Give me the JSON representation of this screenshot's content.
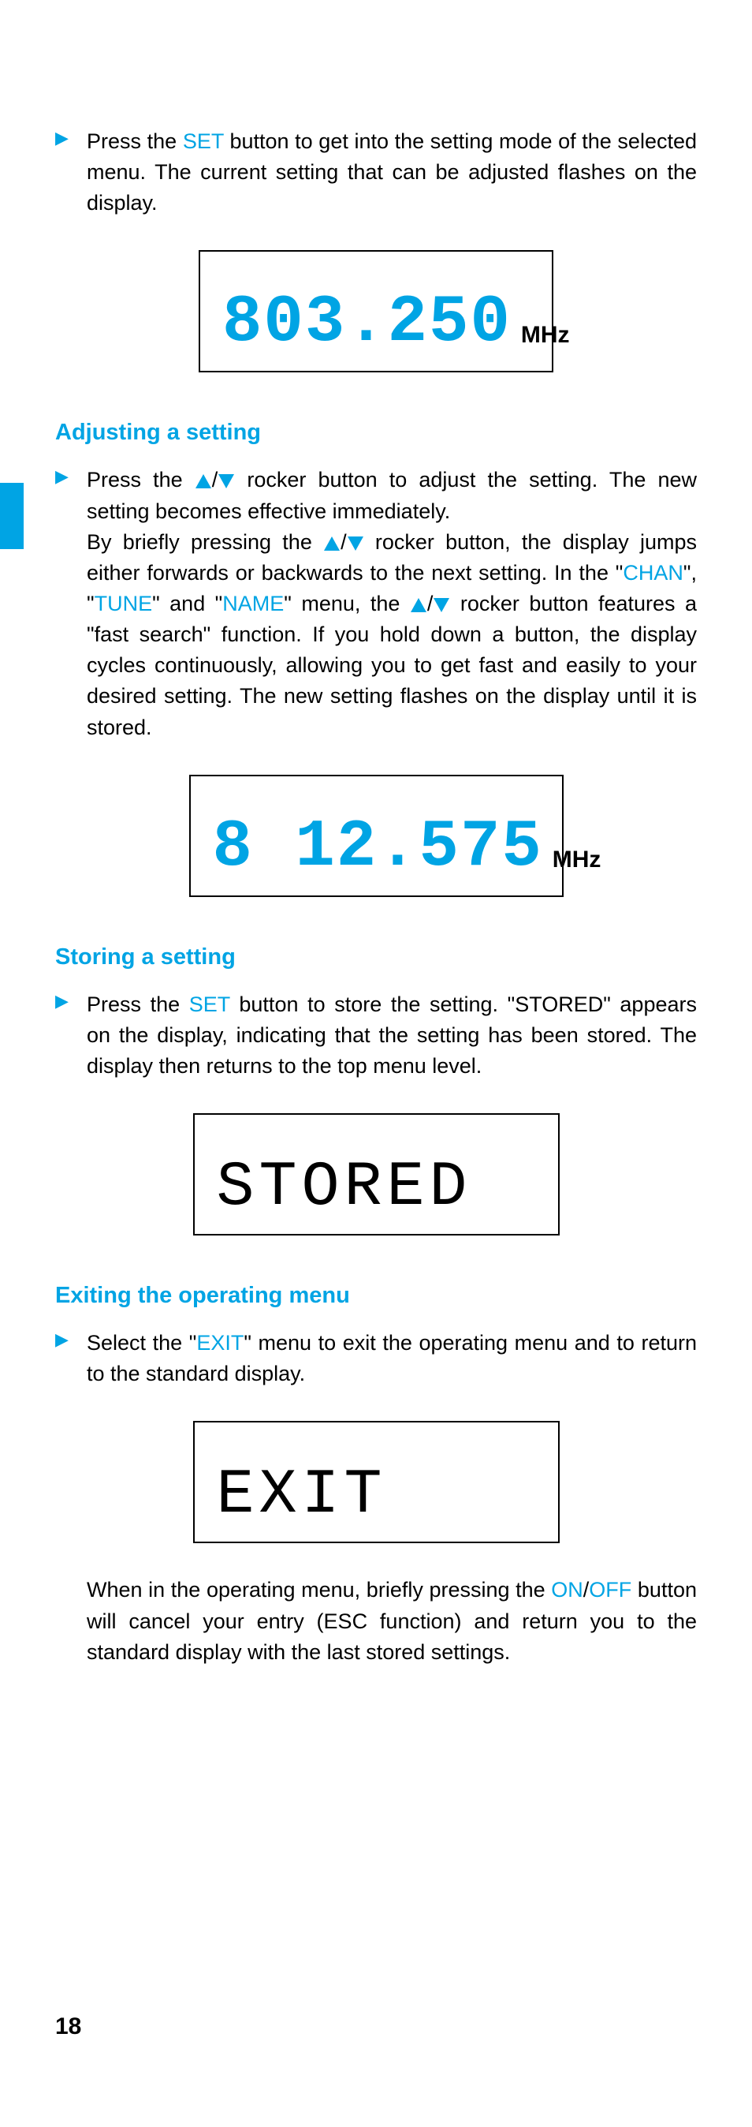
{
  "para1": {
    "pre": "Press the ",
    "hl1": "SET",
    "post": " button to get into the setting mode of the selected menu. The current setting that can be adjusted flashes on the display."
  },
  "lcd1": {
    "digits": "803.250",
    "unit": "MHz"
  },
  "head1": "Adjusting a setting",
  "para2a": "Press the ",
  "para2b": " rocker button to adjust the setting. The new setting becomes effective immediately.",
  "para2c": "By briefly pressing the ",
  "para2d": " rocker button, the display jumps either forwards or backwards to the next setting. In the \"",
  "hl_chan": "CHAN",
  "para2e": "\", \"",
  "hl_tune": "TUNE",
  "para2f": "\" and \"",
  "hl_name": "NAME",
  "para2g": "\" menu, the ",
  "para2h": " rocker button features a \"fast search\" function. If you hold down a button, the display cycles continuously, allowing you to get fast and easily to your desired setting. The new setting flashes on the display until it is stored.",
  "lcd2": {
    "digits": "8 12.575",
    "unit": "MHz"
  },
  "head2": "Storing a setting",
  "para3": {
    "pre": "Press the ",
    "hl1": "SET",
    "post": " button to store the setting. \"STORED\" appears on the display, indicating that the setting has been stored. The display then returns to the top menu level."
  },
  "lcd3": {
    "text": "STORED"
  },
  "head3": "Exiting the operating menu",
  "para4": {
    "pre": "Select the \"",
    "hl1": "EXIT",
    "post": "\" menu to exit the operating menu and to return to the standard display."
  },
  "lcd4": {
    "text": "EXIT"
  },
  "para5a": "When in the operating menu, briefly pressing the ",
  "hl_on": "ON",
  "para5b": "/",
  "hl_off": "OFF",
  "para5c": " button will cancel your entry (ESC function) and return you to the standard display with the last stored settings.",
  "pagenum": "18"
}
